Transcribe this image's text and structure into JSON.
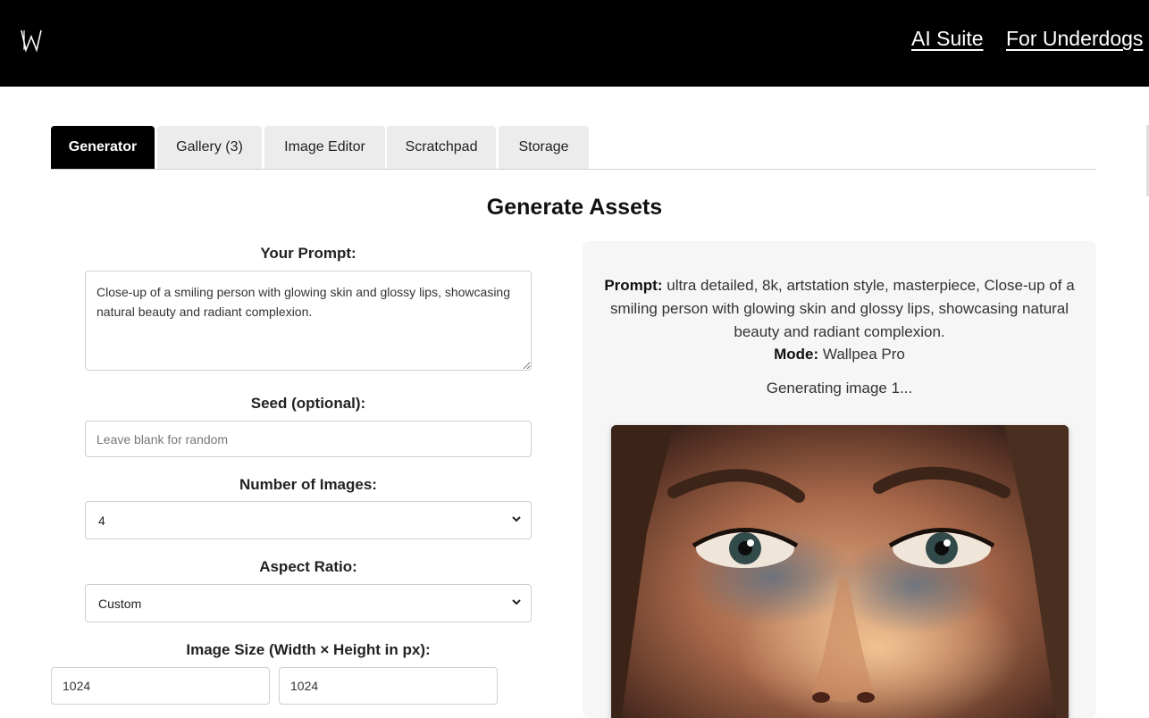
{
  "header": {
    "logo": "W",
    "links": [
      "AI Suite",
      "For Underdogs"
    ]
  },
  "tabs": [
    "Generator",
    "Gallery (3)",
    "Image Editor",
    "Scratchpad",
    "Storage"
  ],
  "active_tab": "Generator",
  "main": {
    "title": "Generate Assets"
  },
  "form": {
    "prompt_label": "Your Prompt:",
    "prompt_value": "Close-up of a smiling person with glowing skin and glossy lips, showcasing natural beauty and radiant complexion.",
    "seed_label": "Seed (optional):",
    "seed_placeholder": "Leave blank for random",
    "num_images_label": "Number of Images:",
    "num_images_value": "4",
    "aspect_label": "Aspect Ratio:",
    "aspect_value": "Custom",
    "size_label": "Image Size (Width × Height in px):",
    "width_value": "1024",
    "height_value": "1024"
  },
  "preview": {
    "prompt_key": "Prompt:",
    "prompt_text": "ultra detailed, 8k, artstation style, masterpiece, Close-up of a smiling person with glowing skin and glossy lips, showcasing natural beauty and radiant complexion.",
    "mode_key": "Mode:",
    "mode_text": "Wallpea Pro",
    "status": "Generating image 1..."
  },
  "icons": {
    "select_arrow": "chevron-down-icon"
  }
}
